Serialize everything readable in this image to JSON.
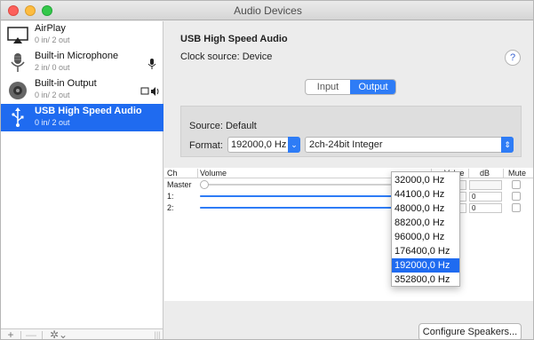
{
  "window": {
    "title": "Audio Devices"
  },
  "sidebar": {
    "devices": [
      {
        "name": "AirPlay",
        "io": "0 in/ 2 out"
      },
      {
        "name": "Built-in Microphone",
        "io": "2 in/ 0 out"
      },
      {
        "name": "Built-in Output",
        "io": "0 in/ 2 out"
      },
      {
        "name": "USB High Speed Audio",
        "io": "0 in/ 2 out",
        "selected": true
      }
    ],
    "bottombar": {
      "add": "+",
      "remove": "—",
      "gear": "✲⌄",
      "grip": "|||"
    }
  },
  "main": {
    "device_title": "USB High Speed Audio",
    "clock": "Clock source:  Device",
    "help": "?",
    "tabs": {
      "input": "Input",
      "output": "Output",
      "selected": "Output"
    },
    "source": "Source:  Default",
    "format_label": "Format:",
    "sample_rate": "192000,0 Hz",
    "channel_format": "2ch-24bit Integer",
    "table": {
      "headers": {
        "ch": "Ch",
        "volume": "Volume",
        "value": "Value",
        "db": "dB",
        "mute": "Mute"
      },
      "rows": [
        {
          "ch": "Master",
          "value": "",
          "db": "",
          "level": 0
        },
        {
          "ch": "1:",
          "value": "1",
          "db": "0",
          "level": 1
        },
        {
          "ch": "2:",
          "value": "1",
          "db": "0",
          "level": 1
        }
      ]
    },
    "rate_options": [
      "32000,0 Hz",
      "44100,0 Hz",
      "48000,0 Hz",
      "88200,0 Hz",
      "96000,0 Hz",
      "176400,0 Hz",
      "192000,0 Hz",
      "352800,0 Hz"
    ],
    "configure_button": "Configure Speakers..."
  },
  "colors": {
    "accent": "#1f6bf0",
    "selected_row": "#1f6bf0"
  }
}
